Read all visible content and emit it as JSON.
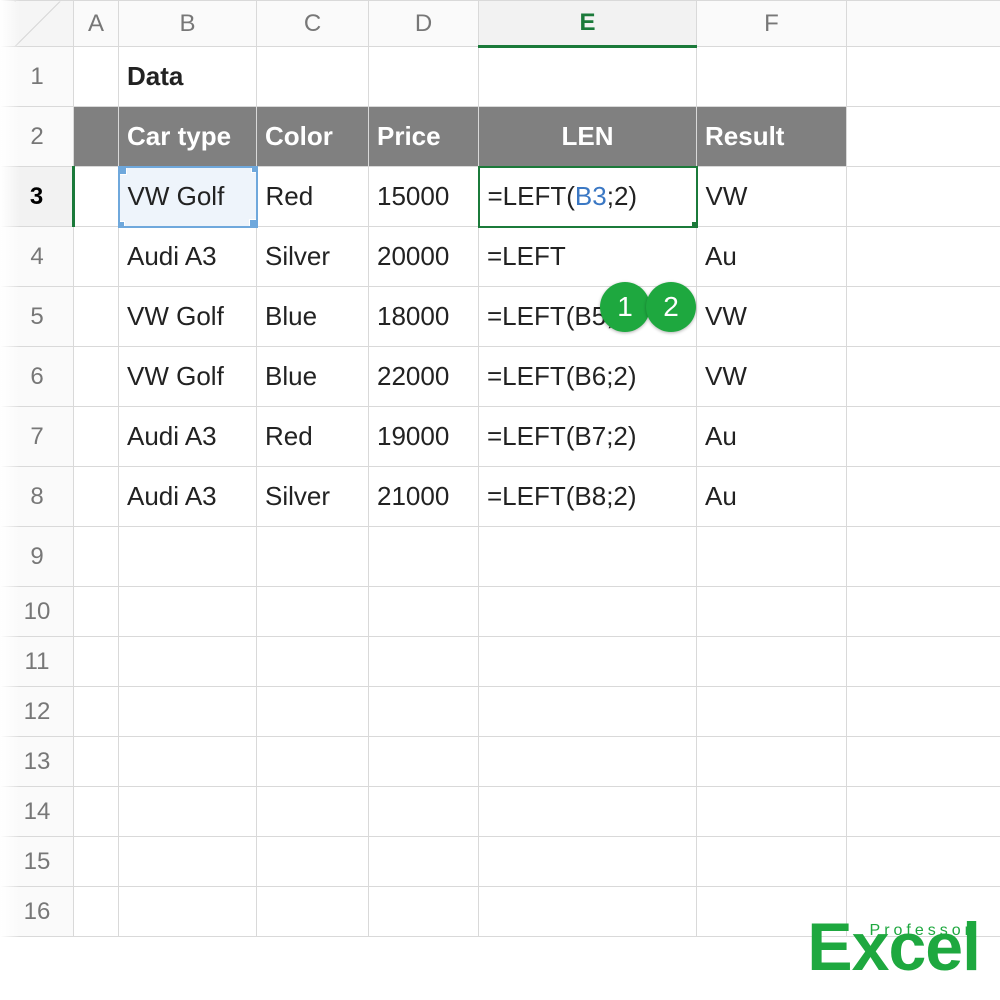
{
  "columns": [
    "A",
    "B",
    "C",
    "D",
    "E",
    "F"
  ],
  "active_column": "E",
  "active_row": "3",
  "row_numbers": [
    "1",
    "2",
    "3",
    "4",
    "5",
    "6",
    "7",
    "8",
    "9",
    "10",
    "11",
    "12",
    "13",
    "14",
    "15",
    "16"
  ],
  "title_cell": "Data",
  "headers": {
    "B": "Car type",
    "C": "Color",
    "D": "Price",
    "E": "LEN",
    "F": "Result"
  },
  "rows": [
    {
      "B": "VW Golf",
      "C": "Red",
      "D": "15000",
      "E_pre": "=LEFT(",
      "E_ref": "B3",
      "E_post": ";2)",
      "F": "VW"
    },
    {
      "B": "Audi A3",
      "C": "Silver",
      "D": "20000",
      "E_pre": "=LEFT",
      "E_ref": "",
      "E_post": "",
      "F": "Au"
    },
    {
      "B": "VW Golf",
      "C": "Blue",
      "D": "18000",
      "E_pre": "=LEFT(B5;2)",
      "E_ref": "",
      "E_post": "",
      "F": "VW"
    },
    {
      "B": "VW Golf",
      "C": "Blue",
      "D": "22000",
      "E_pre": "=LEFT(B6;2)",
      "E_ref": "",
      "E_post": "",
      "F": "VW"
    },
    {
      "B": "Audi A3",
      "C": "Red",
      "D": "19000",
      "E_pre": "=LEFT(B7;2)",
      "E_ref": "",
      "E_post": "",
      "F": "Au"
    },
    {
      "B": "Audi A3",
      "C": "Silver",
      "D": "21000",
      "E_pre": "=LEFT(B8;2)",
      "E_ref": "",
      "E_post": "",
      "F": "Au"
    }
  ],
  "badges": {
    "b1": "1",
    "b2": "2"
  },
  "watermark": {
    "small": "Professor",
    "big": "Excel"
  }
}
